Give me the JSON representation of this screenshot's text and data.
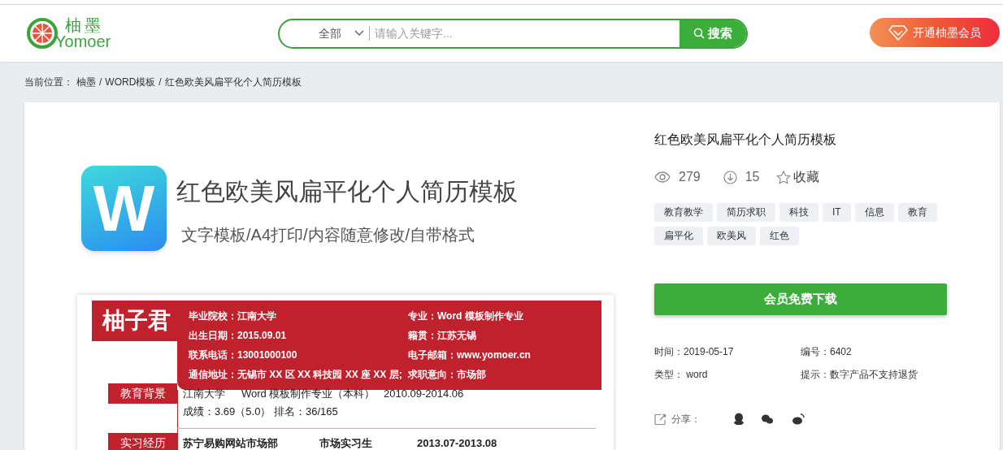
{
  "header": {
    "logo": {
      "mark_text": "柚墨",
      "wordmark": "Yomoer"
    },
    "search": {
      "category": "全部",
      "placeholder": "请输入关键字...",
      "button": "搜索"
    },
    "vip_button": "开通柚墨会员"
  },
  "breadcrumb": {
    "prefix": "当前位置：",
    "separator": "/",
    "items": [
      "柚墨",
      "WORD模板",
      "红色欧美风扁平化个人简历模板"
    ]
  },
  "preview": {
    "banner": {
      "icon_letter": "W",
      "title": "红色欧美风扁平化个人简历模板",
      "subtitle": "文字模板/A4打印/内容随意修改/自带格式"
    },
    "resume": {
      "name": "柚子君",
      "info": [
        [
          "毕业院校：江南大学",
          "专业：Word 模板制作专业"
        ],
        [
          "出生日期：2015.09.01",
          "籍贯：江苏无锡"
        ],
        [
          "联系电话：13001000100",
          "电子邮箱：www.yomoer.cn"
        ],
        [
          "通信地址：无锡市 XX 区 XX 科技园 XX 座 XX 层;",
          "求职意向：市场部"
        ]
      ],
      "sections": [
        {
          "title": "教育背景",
          "lines": [
            [
              "江南大学",
              "Word 模板制作专业（本科）",
              "2010.09-2014.06"
            ],
            [
              "成绩：3.69（5.0）",
              "排名：36/165"
            ]
          ]
        },
        {
          "title": "实习经历",
          "lines": [
            [
              "苏宁易购网站市场部",
              "市场实习生",
              "2013.07-2013.08"
            ]
          ]
        }
      ]
    }
  },
  "detail": {
    "title": "红色欧美风扁平化个人简历模板",
    "views": "279",
    "downloads": "15",
    "favorite": "收藏",
    "tags": [
      "教育教学",
      "简历求职",
      "科技",
      "IT",
      "信息",
      "教育",
      "扁平化",
      "欧美风",
      "红色"
    ],
    "download_button": "会员免费下载",
    "meta": [
      [
        "时间：2019-05-17",
        "编号：6402"
      ],
      [
        "类型： word",
        "提示：数字产品不支持退货"
      ]
    ],
    "share_label": "分享："
  }
}
